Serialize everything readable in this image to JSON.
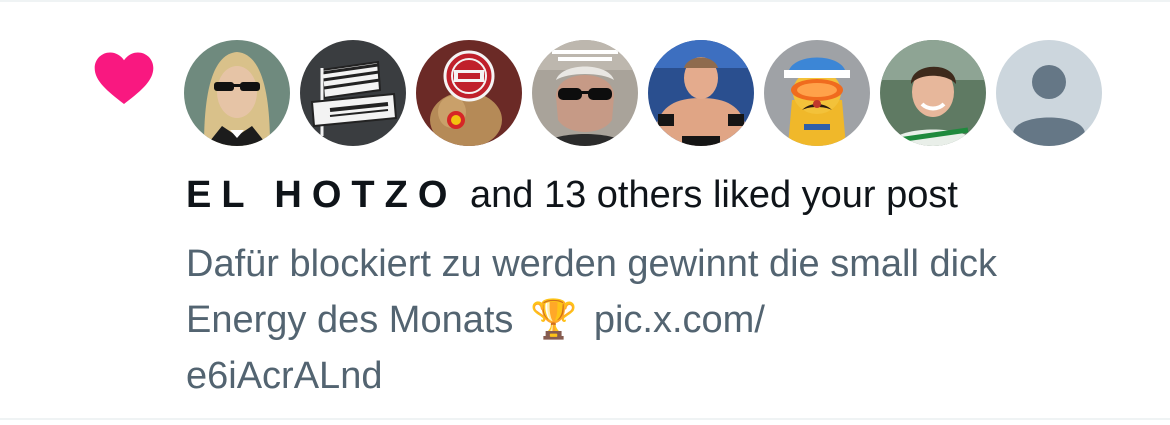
{
  "notification": {
    "type": "like",
    "heart_color": "#f91880",
    "avatars": [
      {
        "icon": "avatar-photo",
        "desc": "person with sunglasses and mullet"
      },
      {
        "icon": "hertha-bsc-logo",
        "desc": "Hertha BSC crest"
      },
      {
        "icon": "fcn-logo",
        "desc": "1. FCN badge"
      },
      {
        "icon": "avatar-photo",
        "desc": "man with sunglasses"
      },
      {
        "icon": "avatar-photo",
        "desc": "wrestler"
      },
      {
        "icon": "avatar-photo",
        "desc": "mascot with goggles"
      },
      {
        "icon": "avatar-photo",
        "desc": "smiling young man"
      },
      {
        "icon": "default-avatar-icon",
        "desc": "default profile"
      }
    ],
    "actor_name": "EL HOTZO",
    "action_text": "and 13 others liked your post",
    "post_text": "Dafür blockiert zu werden gewinnt die small dick Energy des Monats",
    "post_emoji": "🏆",
    "post_link": "pic.x.com/\ne6iAcrALnd"
  }
}
